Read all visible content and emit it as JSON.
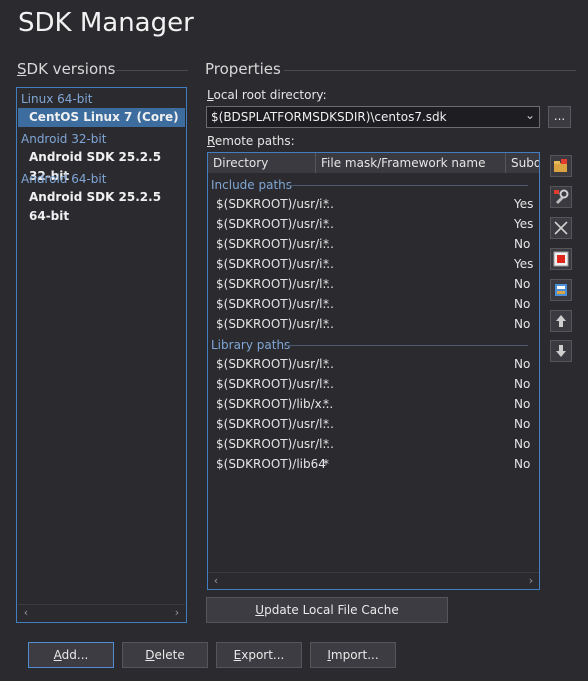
{
  "window_title": "SDK Manager",
  "sdk_versions": {
    "heading_first": "S",
    "heading_rest": "DK versions",
    "groups": [
      {
        "label": "Linux 64-bit",
        "items": [
          "CentOS Linux 7 (Core)"
        ]
      },
      {
        "label": "Android 32-bit",
        "items": [
          "Android SDK 25.2.5 32-bit"
        ]
      },
      {
        "label": "Android 64-bit",
        "items": [
          "Android SDK 25.2.5 64-bit"
        ]
      }
    ],
    "selected": "CentOS Linux 7 (Core)"
  },
  "properties": {
    "heading": "Properties",
    "local_root_label_first": "L",
    "local_root_label_rest": "ocal root directory:",
    "local_root_value": "$(BDSPLATFORMSDKSDIR)\\centos7.sdk",
    "browse_label": "...",
    "remote_paths_label_first": "R",
    "remote_paths_label_rest": "emote paths:",
    "columns": [
      "Directory",
      "File mask/Framework name",
      "Subdi"
    ],
    "include_group": "Include paths",
    "include_rows": [
      {
        "dir": "$(SDKROOT)/usr/i...",
        "mask": "*",
        "sub": "Yes"
      },
      {
        "dir": "$(SDKROOT)/usr/i...",
        "mask": "*",
        "sub": "Yes"
      },
      {
        "dir": "$(SDKROOT)/usr/i...",
        "mask": "*",
        "sub": "No"
      },
      {
        "dir": "$(SDKROOT)/usr/i...",
        "mask": "*",
        "sub": "Yes"
      },
      {
        "dir": "$(SDKROOT)/usr/l...",
        "mask": "*",
        "sub": "No"
      },
      {
        "dir": "$(SDKROOT)/usr/l...",
        "mask": "*",
        "sub": "No"
      },
      {
        "dir": "$(SDKROOT)/usr/l...",
        "mask": "*",
        "sub": "No"
      }
    ],
    "library_group": "Library paths",
    "library_rows": [
      {
        "dir": "$(SDKROOT)/usr/l...",
        "mask": "*",
        "sub": "No"
      },
      {
        "dir": "$(SDKROOT)/usr/l...",
        "mask": "*",
        "sub": "No"
      },
      {
        "dir": "$(SDKROOT)/lib/x...",
        "mask": "*",
        "sub": "No"
      },
      {
        "dir": "$(SDKROOT)/usr/l...",
        "mask": "*",
        "sub": "No"
      },
      {
        "dir": "$(SDKROOT)/usr/l...",
        "mask": "*",
        "sub": "No"
      },
      {
        "dir": "$(SDKROOT)/lib64",
        "mask": "*",
        "sub": "No"
      }
    ],
    "update_cache_first": "U",
    "update_cache_rest": "pdate Local File Cache",
    "toolbar_icons": [
      "add-path-icon",
      "add-framework-icon",
      "delete-icon",
      "stop-icon",
      "edit-icon",
      "move-up-icon",
      "move-down-icon"
    ]
  },
  "footer": {
    "add_first": "A",
    "add_rest": "dd...",
    "delete_first": "D",
    "delete_rest": "elete",
    "export_first": "E",
    "export_rest": "xport...",
    "import_first": "I",
    "import_rest": "mport..."
  },
  "colors": {
    "accent": "#3f7fbf",
    "selection": "#3d6d9e",
    "group_text": "#7fa6d6",
    "background": "#2b2b2f"
  }
}
